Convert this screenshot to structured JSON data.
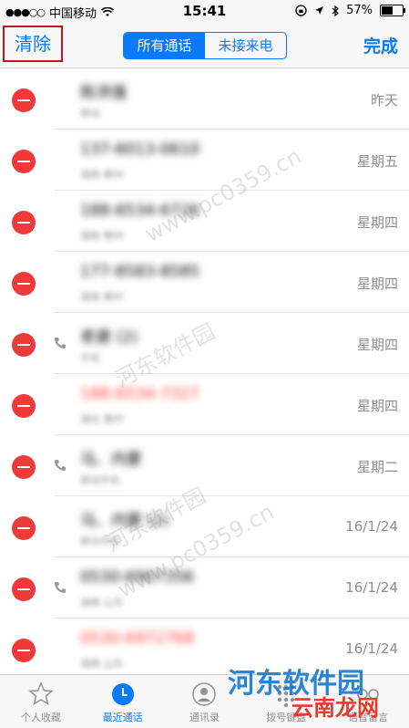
{
  "status_bar": {
    "carrier": "中国移动",
    "time": "15:41",
    "battery": "57%",
    "battery_level": 0.57
  },
  "nav": {
    "clear_label": "清除",
    "segments": [
      "所有通话",
      "未接来电"
    ],
    "done_label": "完成"
  },
  "calls": [
    {
      "name": "陈洪强",
      "sub": "移动",
      "date": "昨天",
      "missed": false,
      "outgoing": false
    },
    {
      "name": "137-6013-0610",
      "sub": "湖南 郴州",
      "date": "星期五",
      "missed": false,
      "outgoing": false
    },
    {
      "name": "188-6534-6726",
      "sub": "湖南 郴州",
      "date": "星期四",
      "missed": false,
      "outgoing": false
    },
    {
      "name": "177-8583-8585",
      "sub": "湖南 郴州",
      "date": "星期四",
      "missed": false,
      "outgoing": false
    },
    {
      "name": "老婆 (2)",
      "sub": "手机",
      "date": "星期四",
      "missed": false,
      "outgoing": true
    },
    {
      "name": "188-6534-7327",
      "sub": "湖北 黄州",
      "date": "星期四",
      "missed": true,
      "outgoing": false
    },
    {
      "name": "马、内蒙",
      "sub": "移动手机",
      "date": "星期二",
      "missed": false,
      "outgoing": true
    },
    {
      "name": "马、内蒙 (2)",
      "sub": "移动手机",
      "date": "16/1/24",
      "missed": false,
      "outgoing": false
    },
    {
      "name": "0530-6907356",
      "sub": "湖南 山东",
      "date": "16/1/24",
      "missed": false,
      "outgoing": true
    },
    {
      "name": "0530-6972768",
      "sub": "湖南 山东",
      "date": "16/1/24",
      "missed": true,
      "outgoing": false
    }
  ],
  "tabs": [
    {
      "label": "个人收藏",
      "icon": "star-icon",
      "active": false
    },
    {
      "label": "最近通话",
      "icon": "clock-icon",
      "active": true
    },
    {
      "label": "通讯录",
      "icon": "contacts-icon",
      "active": false
    },
    {
      "label": "拨号键盘",
      "icon": "keypad-icon",
      "active": false
    },
    {
      "label": "语音留言",
      "icon": "voicemail-icon",
      "active": false
    }
  ],
  "watermark": {
    "text_cn": "河东软件园",
    "text_url": "www.pc0359.cn",
    "logo_text": "河东软件园",
    "logo_sub": "云南龙网"
  },
  "colors": {
    "accent": "#0a7afc",
    "delete": "#f03a3a",
    "highlight_box": "#c4161c"
  }
}
